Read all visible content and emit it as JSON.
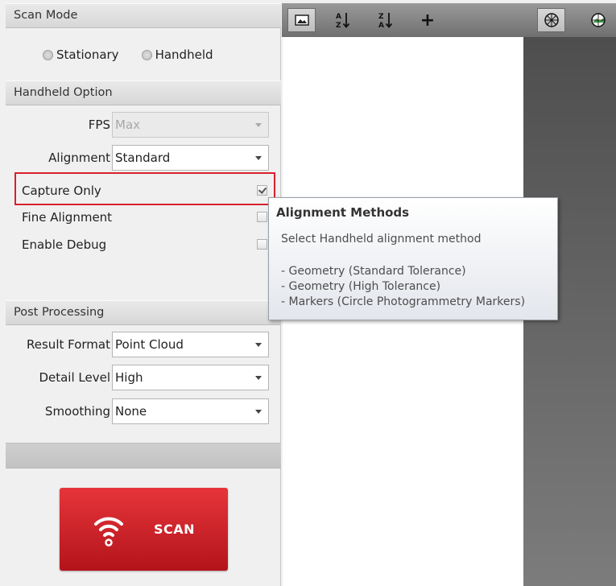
{
  "scan_mode": {
    "header": "Scan Mode",
    "options": [
      "Stationary",
      "Handheld"
    ]
  },
  "handheld_option": {
    "header": "Handheld Option",
    "fps": {
      "label": "FPS",
      "value": "Max"
    },
    "alignment": {
      "label": "Alignment",
      "value": "Standard"
    },
    "checkboxes": [
      {
        "label": "Capture Only",
        "checked": true
      },
      {
        "label": "Fine Alignment",
        "checked": false
      },
      {
        "label": "Enable Debug",
        "checked": false
      }
    ]
  },
  "post_processing": {
    "header": "Post Processing",
    "result_format": {
      "label": "Result Format",
      "value": "Point Cloud"
    },
    "detail_level": {
      "label": "Detail Level",
      "value": "High"
    },
    "smoothing": {
      "label": "Smoothing",
      "value": "None"
    }
  },
  "scan_button": {
    "label": "SCAN",
    "icon": "wifi-signal-icon",
    "color": "#d21f26"
  },
  "toolbar": {
    "icons": [
      "image-icon",
      "sort-az-icon",
      "sort-za-icon",
      "add-icon",
      "mesh-view-icon",
      "texture-view-icon"
    ],
    "sort_az": "A Z",
    "sort_za": "Z A",
    "add": "+"
  },
  "tooltip": {
    "title": "Alignment Methods",
    "description": "Select Handheld alignment method",
    "lines": [
      "- Geometry (Standard Tolerance)",
      "- Geometry (High Tolerance)",
      "- Markers (Circle Photogrammetry Markers)"
    ]
  },
  "highlight_color": "#d8202d"
}
